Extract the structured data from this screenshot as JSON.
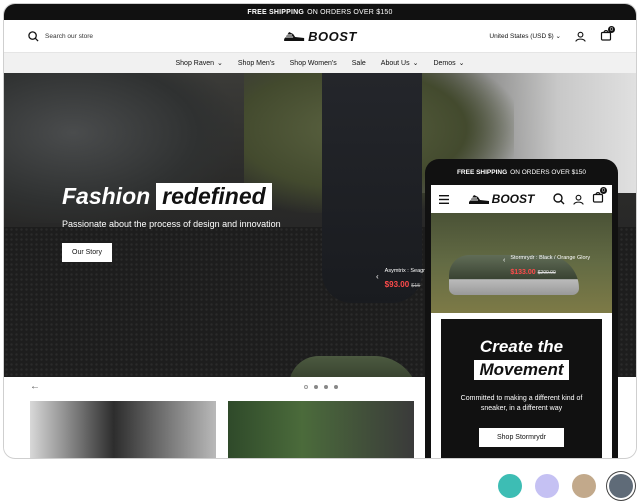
{
  "announcement": {
    "bold": "FREE SHIPPING",
    "rest": "ON ORDERS OVER $150"
  },
  "header": {
    "search_placeholder": "Search our store",
    "logo": "BOOST",
    "currency": "United States (USD $)",
    "cart_count": "0"
  },
  "nav": [
    {
      "label": "Shop Raven",
      "dropdown": true
    },
    {
      "label": "Shop Men's",
      "dropdown": false
    },
    {
      "label": "Shop Women's",
      "dropdown": false
    },
    {
      "label": "Sale",
      "dropdown": false
    },
    {
      "label": "About Us",
      "dropdown": true
    },
    {
      "label": "Demos",
      "dropdown": true
    }
  ],
  "hero": {
    "title_plain": "Fashion",
    "title_boxed": "redefined",
    "subtitle": "Passionate about the process of design and innovation",
    "button": "Our Story",
    "tag": {
      "name": "Asymtrix : Seagr",
      "price": "$93.00",
      "old_price": "$15"
    }
  },
  "phone": {
    "announcement": {
      "bold": "FREE SHIPPING",
      "rest": "ON ORDERS OVER $150"
    },
    "logo": "BOOST",
    "cart_count": "0",
    "tag": {
      "name": "Stormrydr : Black / Orange Glory",
      "price": "$133.00",
      "old_price": "$200.00"
    },
    "panel_line1": "Create the",
    "panel_line2": "Movement",
    "panel_text": "Committed to making a different kind of sneaker, in a different way",
    "panel_button": "Shop Stormrydr"
  },
  "colors": {
    "accent_price": "#ff4b4b",
    "bar": "#111111"
  },
  "swatches": [
    {
      "color": "#3dbdb4",
      "selected": false
    },
    {
      "color": "#c5c1f3",
      "selected": false
    },
    {
      "color": "#c2a98b",
      "selected": false
    },
    {
      "color": "#5f6b78",
      "selected": true
    }
  ]
}
